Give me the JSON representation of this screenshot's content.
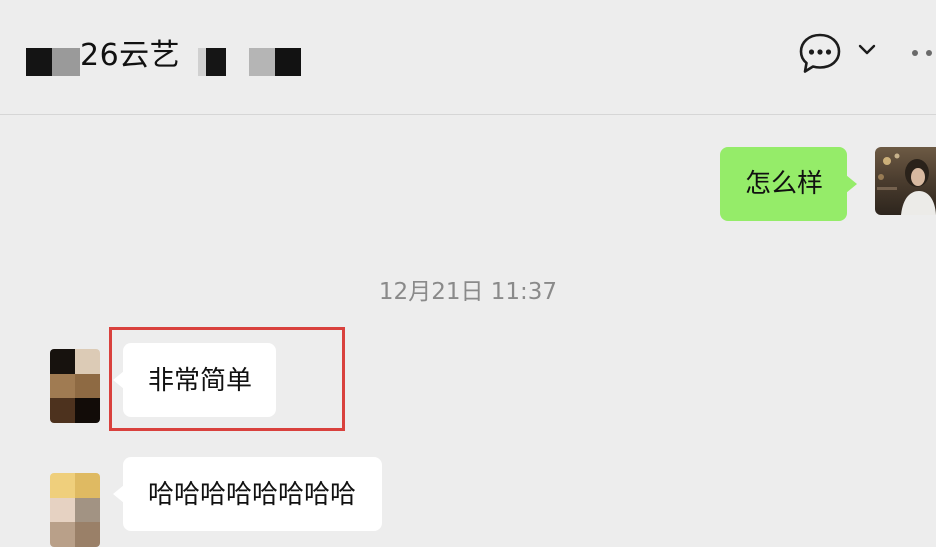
{
  "header": {
    "title": "26云艺",
    "icons": [
      "chat-icon",
      "chevron-down-icon",
      "more-icon"
    ]
  },
  "messages": [
    {
      "from": "me",
      "text": "怎么样"
    },
    {
      "from": "contact",
      "text": "非常简单",
      "highlighted": true
    },
    {
      "from": "contact",
      "text": "哈哈哈哈哈哈哈哈"
    }
  ],
  "timestamp": "12月21日 11:37",
  "colors": {
    "background": "#ededed",
    "self_bubble": "#95ec69",
    "other_bubble": "#ffffff",
    "highlight": "#d9413d"
  }
}
